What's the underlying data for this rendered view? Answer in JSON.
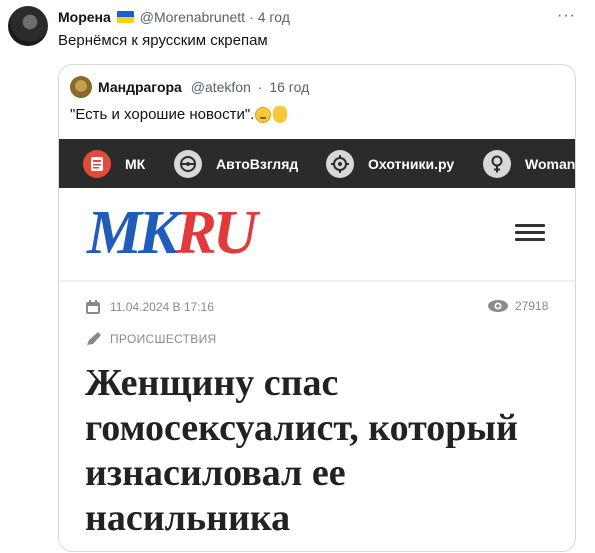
{
  "tweet": {
    "display_name": "Морена",
    "handle": "@Morenabrunett",
    "time": "4 год",
    "separator": "·",
    "text": "Вернёмся к ярусским скрепам",
    "more_label": "···",
    "flag_colors": [
      "#1d5bd6",
      "#f7d116"
    ]
  },
  "quote": {
    "display_name": "Мандрагора",
    "handle": "@atekfon",
    "time": "16 год",
    "text": "\"Есть и хорошие новости\".",
    "emojis": [
      "confused-face-icon",
      "pointing-down-icon"
    ]
  },
  "screenshot": {
    "nav_items": [
      {
        "label": "МК",
        "icon": "newspaper-icon"
      },
      {
        "label": "АвтоВзгляд",
        "icon": "steering-wheel-icon"
      },
      {
        "label": "Охотники.ру",
        "icon": "crosshair-icon"
      },
      {
        "label": "Woman",
        "icon": "female-icon"
      }
    ],
    "logo_mk": "MK",
    "logo_ru": "RU",
    "date": "11.04.2024 В 17:16",
    "views": "27918",
    "category": "ПРОИСШЕСТВИЯ",
    "headline": "Женщину спас гомосексуалист, который изнасиловал ее насильника",
    "colors": {
      "nav_bg": "#2b2b2b",
      "logo_blue": "#1f5db8",
      "logo_red": "#e2393a"
    }
  }
}
